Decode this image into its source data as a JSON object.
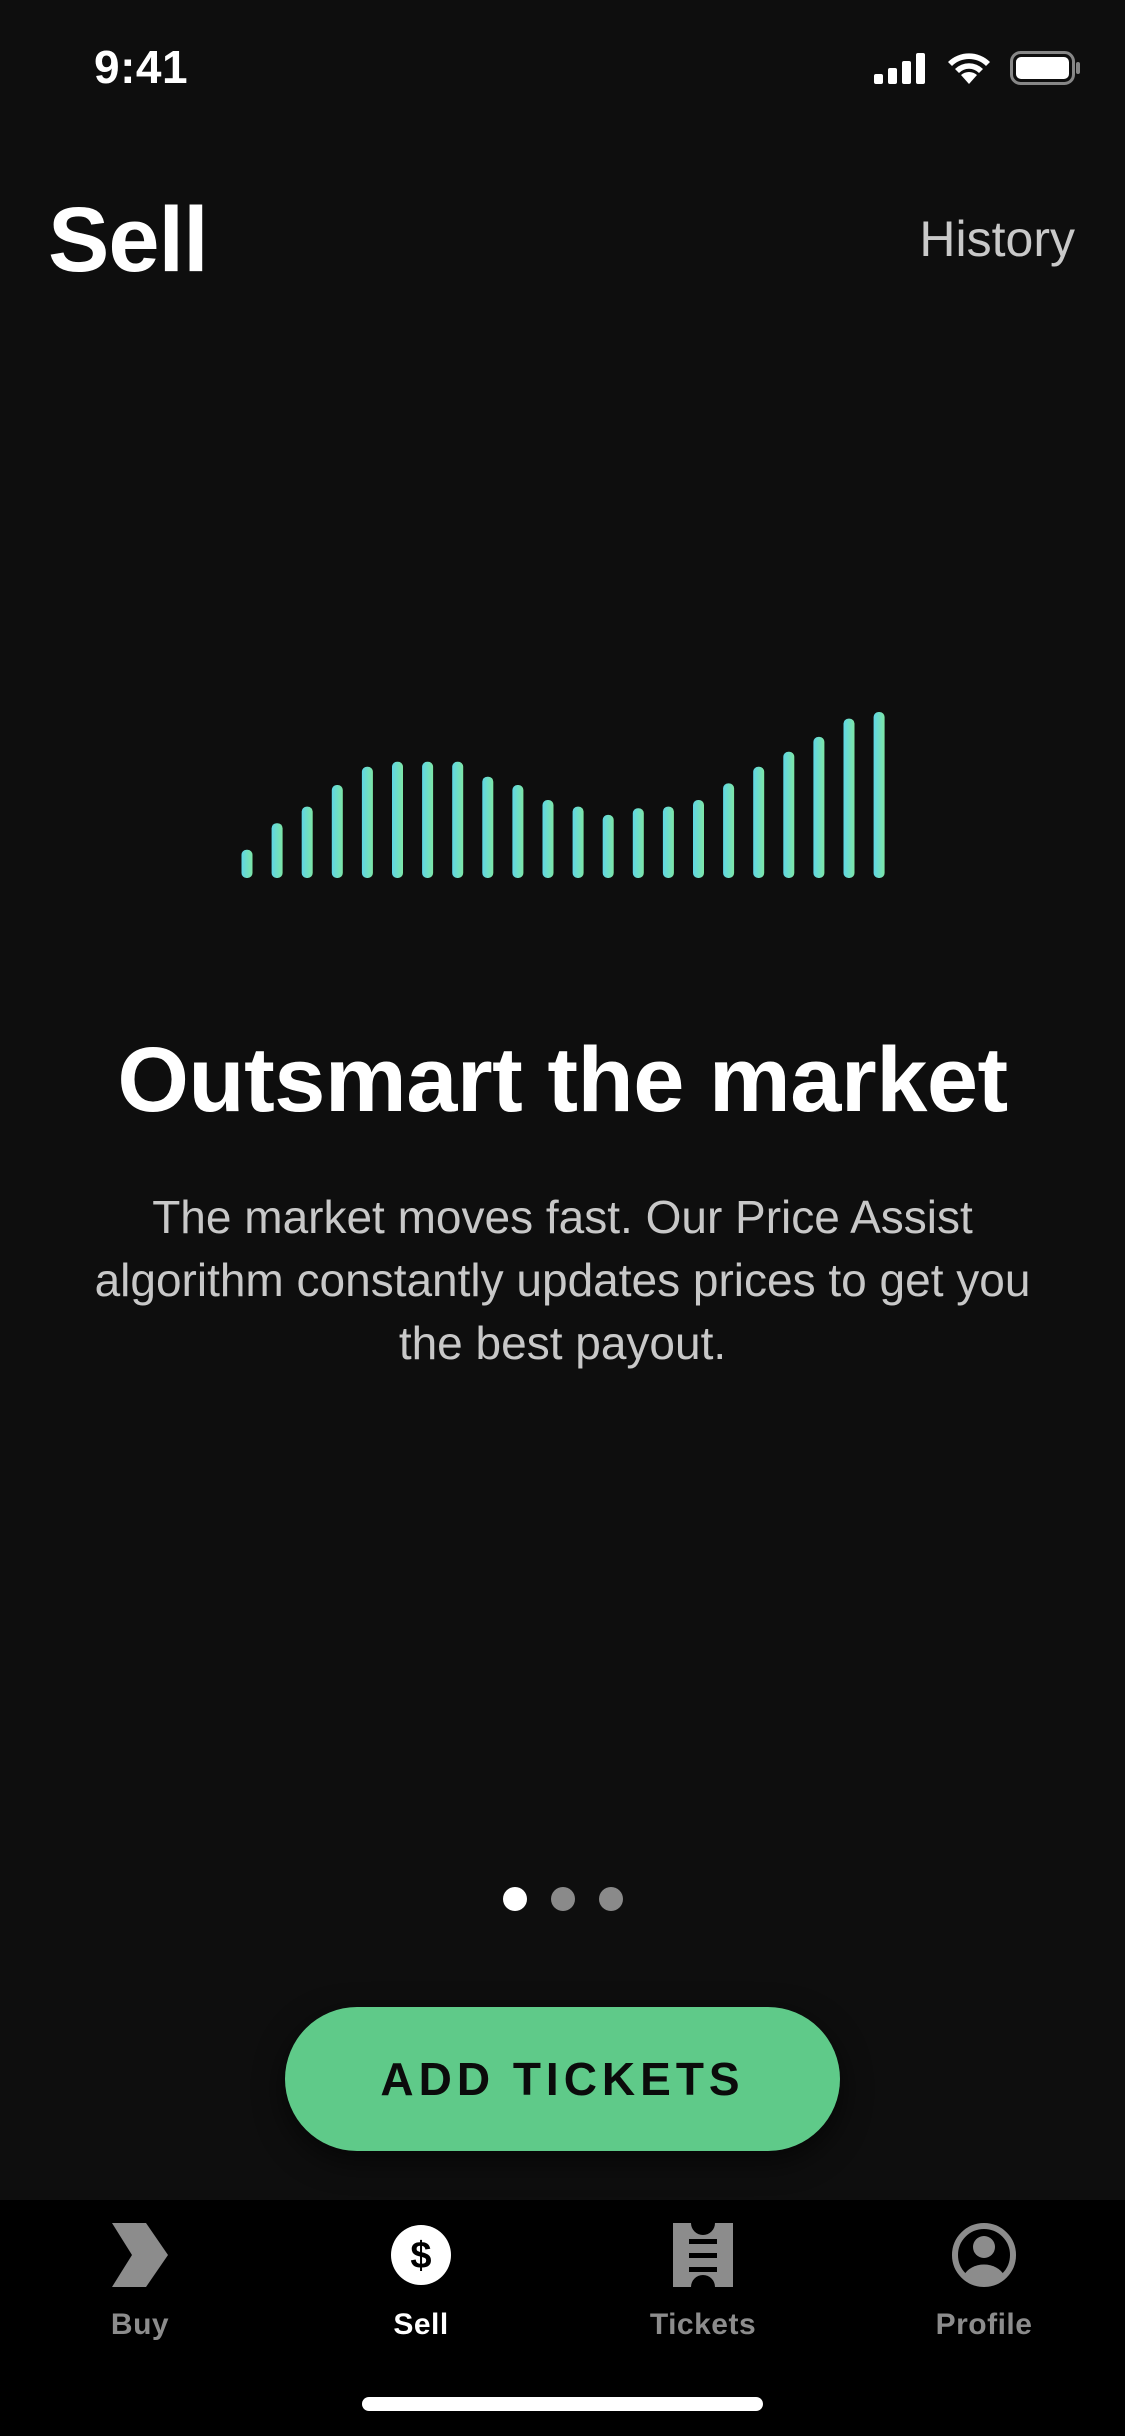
{
  "status_bar": {
    "time": "9:41",
    "icons": [
      "cellular-signal-icon",
      "wifi-icon",
      "battery-icon"
    ]
  },
  "header": {
    "title": "Sell",
    "history_label": "History"
  },
  "illustration": {
    "icon": "price-bars-illustration",
    "gradient_colors": [
      "#5fd6e6",
      "#7ee6a6"
    ],
    "bar_levels": [
      0.17,
      0.33,
      0.43,
      0.56,
      0.67,
      0.7,
      0.7,
      0.7,
      0.61,
      0.56,
      0.47,
      0.43,
      0.38,
      0.42,
      0.43,
      0.47,
      0.57,
      0.67,
      0.76,
      0.85,
      0.96,
      1.0
    ]
  },
  "hero": {
    "heading": "Outsmart the market",
    "body": "The market moves fast. Our Price Assist algorithm constantly updates prices to get you the best payout."
  },
  "pager": {
    "count": 3,
    "active_index": 0
  },
  "cta": {
    "label": "ADD TICKETS",
    "color": "#5fca89"
  },
  "tabbar": {
    "items": [
      {
        "label": "Buy",
        "icon": "buy-chevron-icon",
        "active": false
      },
      {
        "label": "Sell",
        "icon": "dollar-circle-icon",
        "active": true
      },
      {
        "label": "Tickets",
        "icon": "ticket-icon",
        "active": false
      },
      {
        "label": "Profile",
        "icon": "profile-icon",
        "active": false
      }
    ]
  },
  "colors": {
    "background": "#0e0e0e",
    "tabbar_background": "#000000",
    "inactive_tab": "#8c8c8c"
  }
}
